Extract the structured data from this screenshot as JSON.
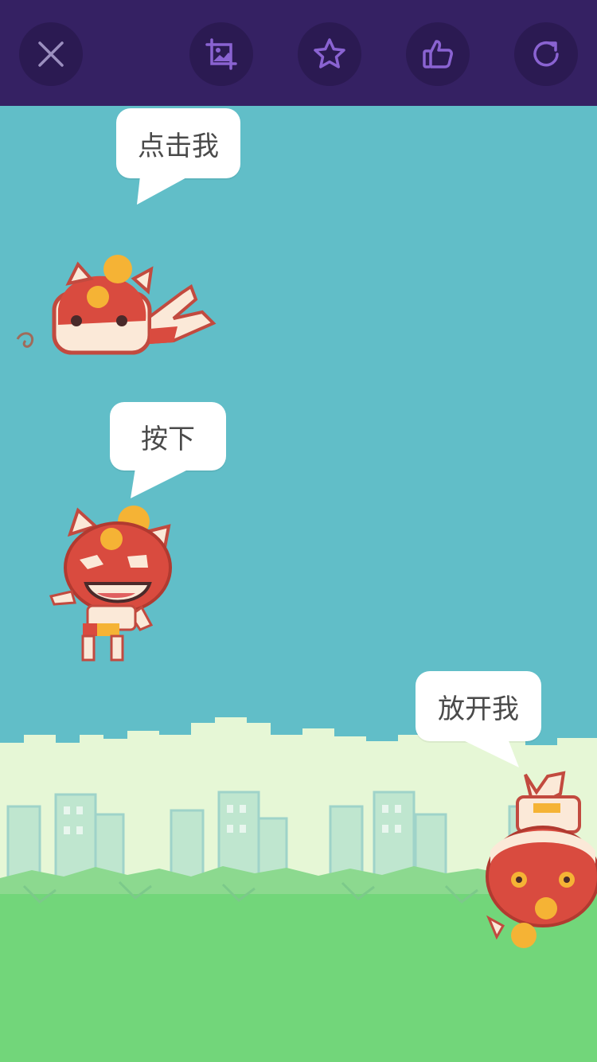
{
  "topbar": {
    "background": "#352163",
    "buttons": [
      {
        "name": "close-button",
        "icon": "close-icon"
      },
      {
        "name": "screenshot-button",
        "icon": "image-crop-icon"
      },
      {
        "name": "favorite-button",
        "icon": "star-icon"
      },
      {
        "name": "like-button",
        "icon": "thumbs-up-icon"
      },
      {
        "name": "refresh-button",
        "icon": "refresh-icon"
      }
    ],
    "icon_color": "#8a63d2"
  },
  "game": {
    "sky_color": "#61bec8",
    "grass_color": "#72d67a",
    "characters": [
      {
        "name": "character-flying",
        "pose": "flying",
        "bubble": "点击我"
      },
      {
        "name": "character-standing",
        "pose": "standing",
        "bubble": "按下"
      },
      {
        "name": "character-falling",
        "pose": "upside-down",
        "bubble": "放开我"
      }
    ]
  }
}
